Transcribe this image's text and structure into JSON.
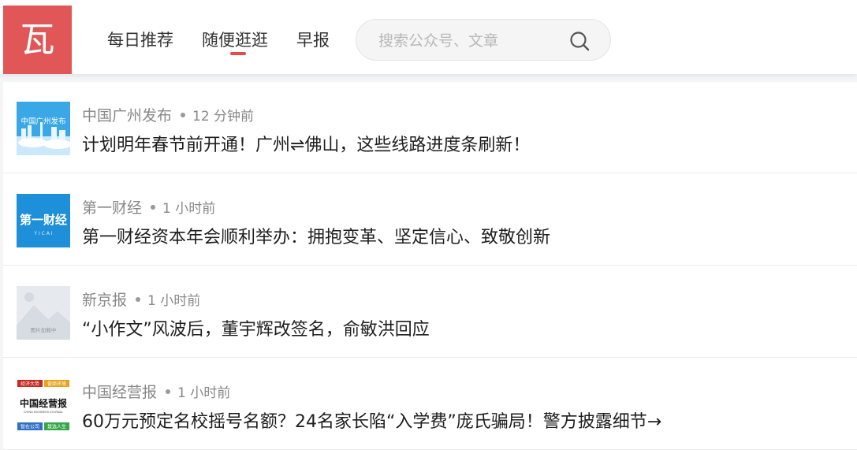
{
  "header": {
    "logo_text": "瓦",
    "nav": [
      {
        "label": "每日推荐"
      },
      {
        "label": "随便逛逛"
      },
      {
        "label": "早报"
      }
    ],
    "search": {
      "placeholder": "搜索公众号、文章",
      "value": ""
    }
  },
  "feed": {
    "items": [
      {
        "source": "中国广州发布",
        "time": "12 分钟前",
        "title": "计划明年春节前开通！广州⇌佛山，这些线路进度条刷新！",
        "thumb_text": "中国广州发布"
      },
      {
        "source": "第一财经",
        "time": "1 小时前",
        "title": "第一财经资本年会顺利举办：拥抱变革、坚定信心、致敬创新",
        "thumb_text": "第一财经",
        "thumb_sub": "Y I C A I"
      },
      {
        "source": "新京报",
        "time": "1 小时前",
        "title": "“小作文”风波后，董宇辉改签名，俞敏洪回应",
        "thumb_text": "图片加载中"
      },
      {
        "source": "中国经营报",
        "time": "1 小时前",
        "title": "60万元预定名校摇号名额？24名家长陷“入学费”庞氏骗局！警方披露细节→",
        "thumb_text": "中国经营报",
        "thumb_top": [
          "经济大势",
          "营商环境"
        ],
        "thumb_bottom": [
          "智在公司",
          "慧选人生"
        ],
        "thumb_en": "CHINA BUSINESS JOURNAL"
      }
    ]
  },
  "colors": {
    "brand": "#e15656",
    "accent_underline": "#e14d4d",
    "meta_text": "#888888"
  }
}
